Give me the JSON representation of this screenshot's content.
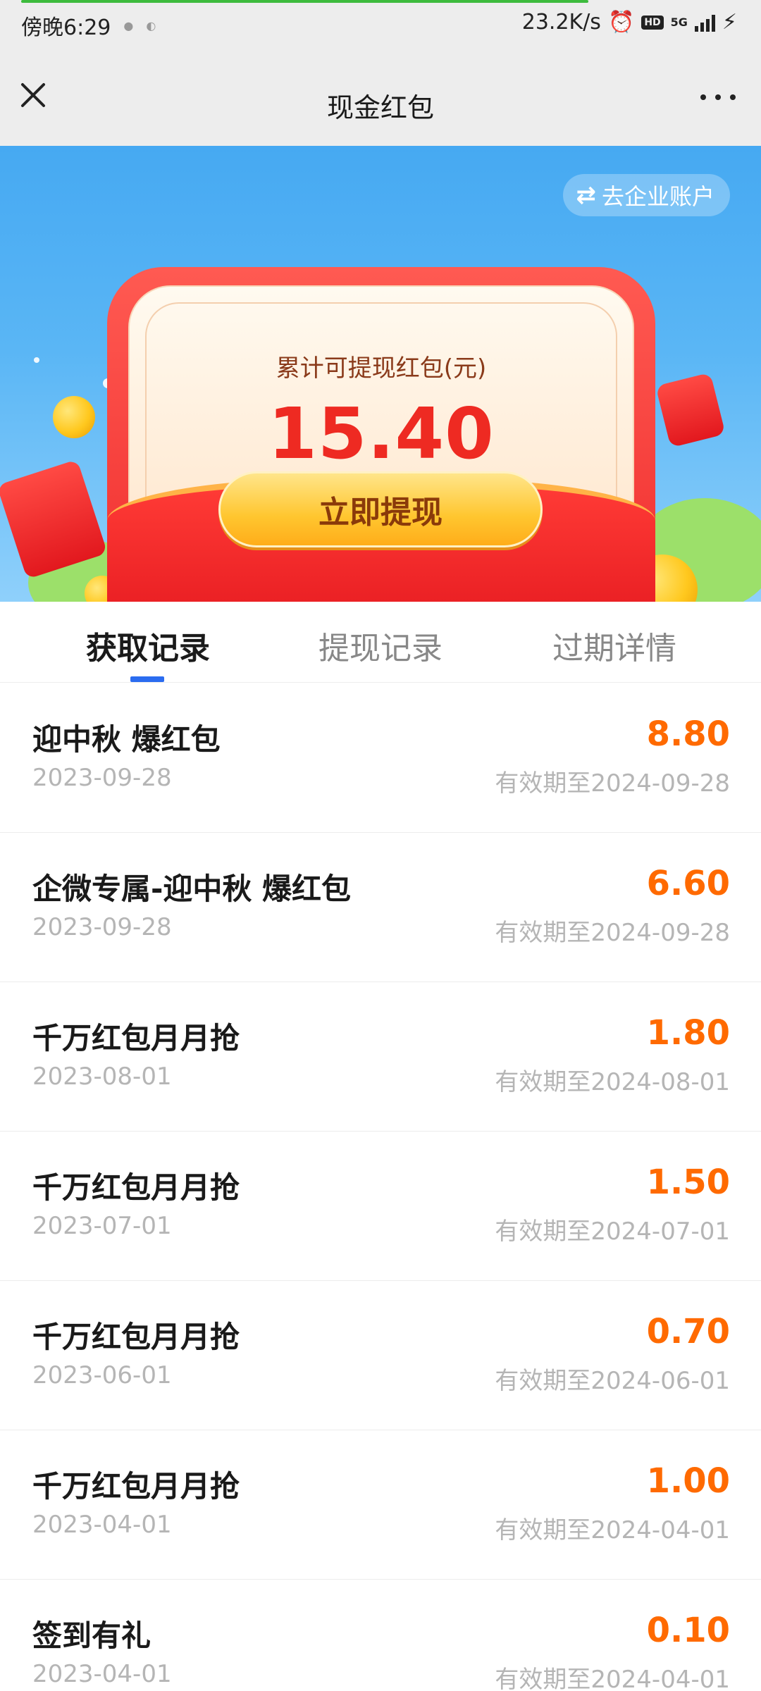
{
  "status_bar": {
    "time": "傍晚6:29",
    "net_speed": "23.2K/s",
    "network": "5G",
    "hd": "HD"
  },
  "nav": {
    "title": "现金红包"
  },
  "hero": {
    "switch_label": "去企业账户",
    "label": "累计可提现红包(元)",
    "amount": "15.40",
    "withdraw_label": "立即提现"
  },
  "tabs": [
    {
      "label": "获取记录",
      "active": true
    },
    {
      "label": "提现记录",
      "active": false
    },
    {
      "label": "过期详情",
      "active": false
    }
  ],
  "records": [
    {
      "title": "迎中秋 爆红包",
      "date": "2023-09-28",
      "amount": "8.80",
      "expiry": "有效期至2024-09-28"
    },
    {
      "title": "企微专属-迎中秋 爆红包",
      "date": "2023-09-28",
      "amount": "6.60",
      "expiry": "有效期至2024-09-28"
    },
    {
      "title": "千万红包月月抢",
      "date": "2023-08-01",
      "amount": "1.80",
      "expiry": "有效期至2024-08-01"
    },
    {
      "title": "千万红包月月抢",
      "date": "2023-07-01",
      "amount": "1.50",
      "expiry": "有效期至2024-07-01"
    },
    {
      "title": "千万红包月月抢",
      "date": "2023-06-01",
      "amount": "0.70",
      "expiry": "有效期至2024-06-01"
    },
    {
      "title": "千万红包月月抢",
      "date": "2023-04-01",
      "amount": "1.00",
      "expiry": "有效期至2024-04-01"
    },
    {
      "title": "签到有礼",
      "date": "2023-04-01",
      "amount": "0.10",
      "expiry": "有效期至2024-04-01"
    }
  ],
  "colors": {
    "accent_blue": "#2b6cf0",
    "amount_orange": "#ff6a00",
    "hero_blue": "#46a9f2",
    "envelope_red": "#f02e2e"
  }
}
